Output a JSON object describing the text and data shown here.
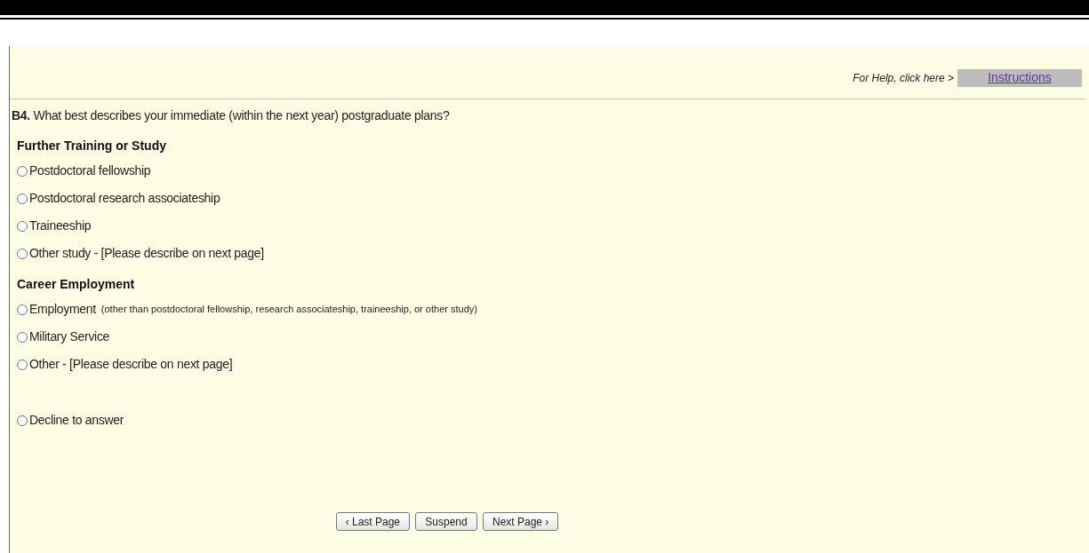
{
  "help": {
    "text": "For Help, click here >",
    "link": "Instructions"
  },
  "question": {
    "number": "B4.",
    "text": "What best describes your immediate (within the next year) postgraduate plans?"
  },
  "groups": [
    {
      "heading": "Further Training or Study",
      "options": [
        {
          "label": "Postdoctoral fellowship",
          "selected": false
        },
        {
          "label": "Postdoctoral research associateship",
          "selected": false
        },
        {
          "label": "Traineeship",
          "selected": false
        },
        {
          "label": "Other study - [Please describe on next page]",
          "selected": false
        }
      ]
    },
    {
      "heading": "Career Employment",
      "options": [
        {
          "label": "Employment",
          "note": "(other than postdoctoral fellowship, research associateship, traineeship, or other study)",
          "selected": false
        },
        {
          "label": "Military Service",
          "selected": false
        },
        {
          "label": "Other - [Please describe on next page]",
          "selected": false
        }
      ]
    }
  ],
  "decline": {
    "label": "Decline to answer",
    "selected": false
  },
  "buttons": [
    "‹ Last Page",
    "Suspend",
    "Next Page ›"
  ]
}
